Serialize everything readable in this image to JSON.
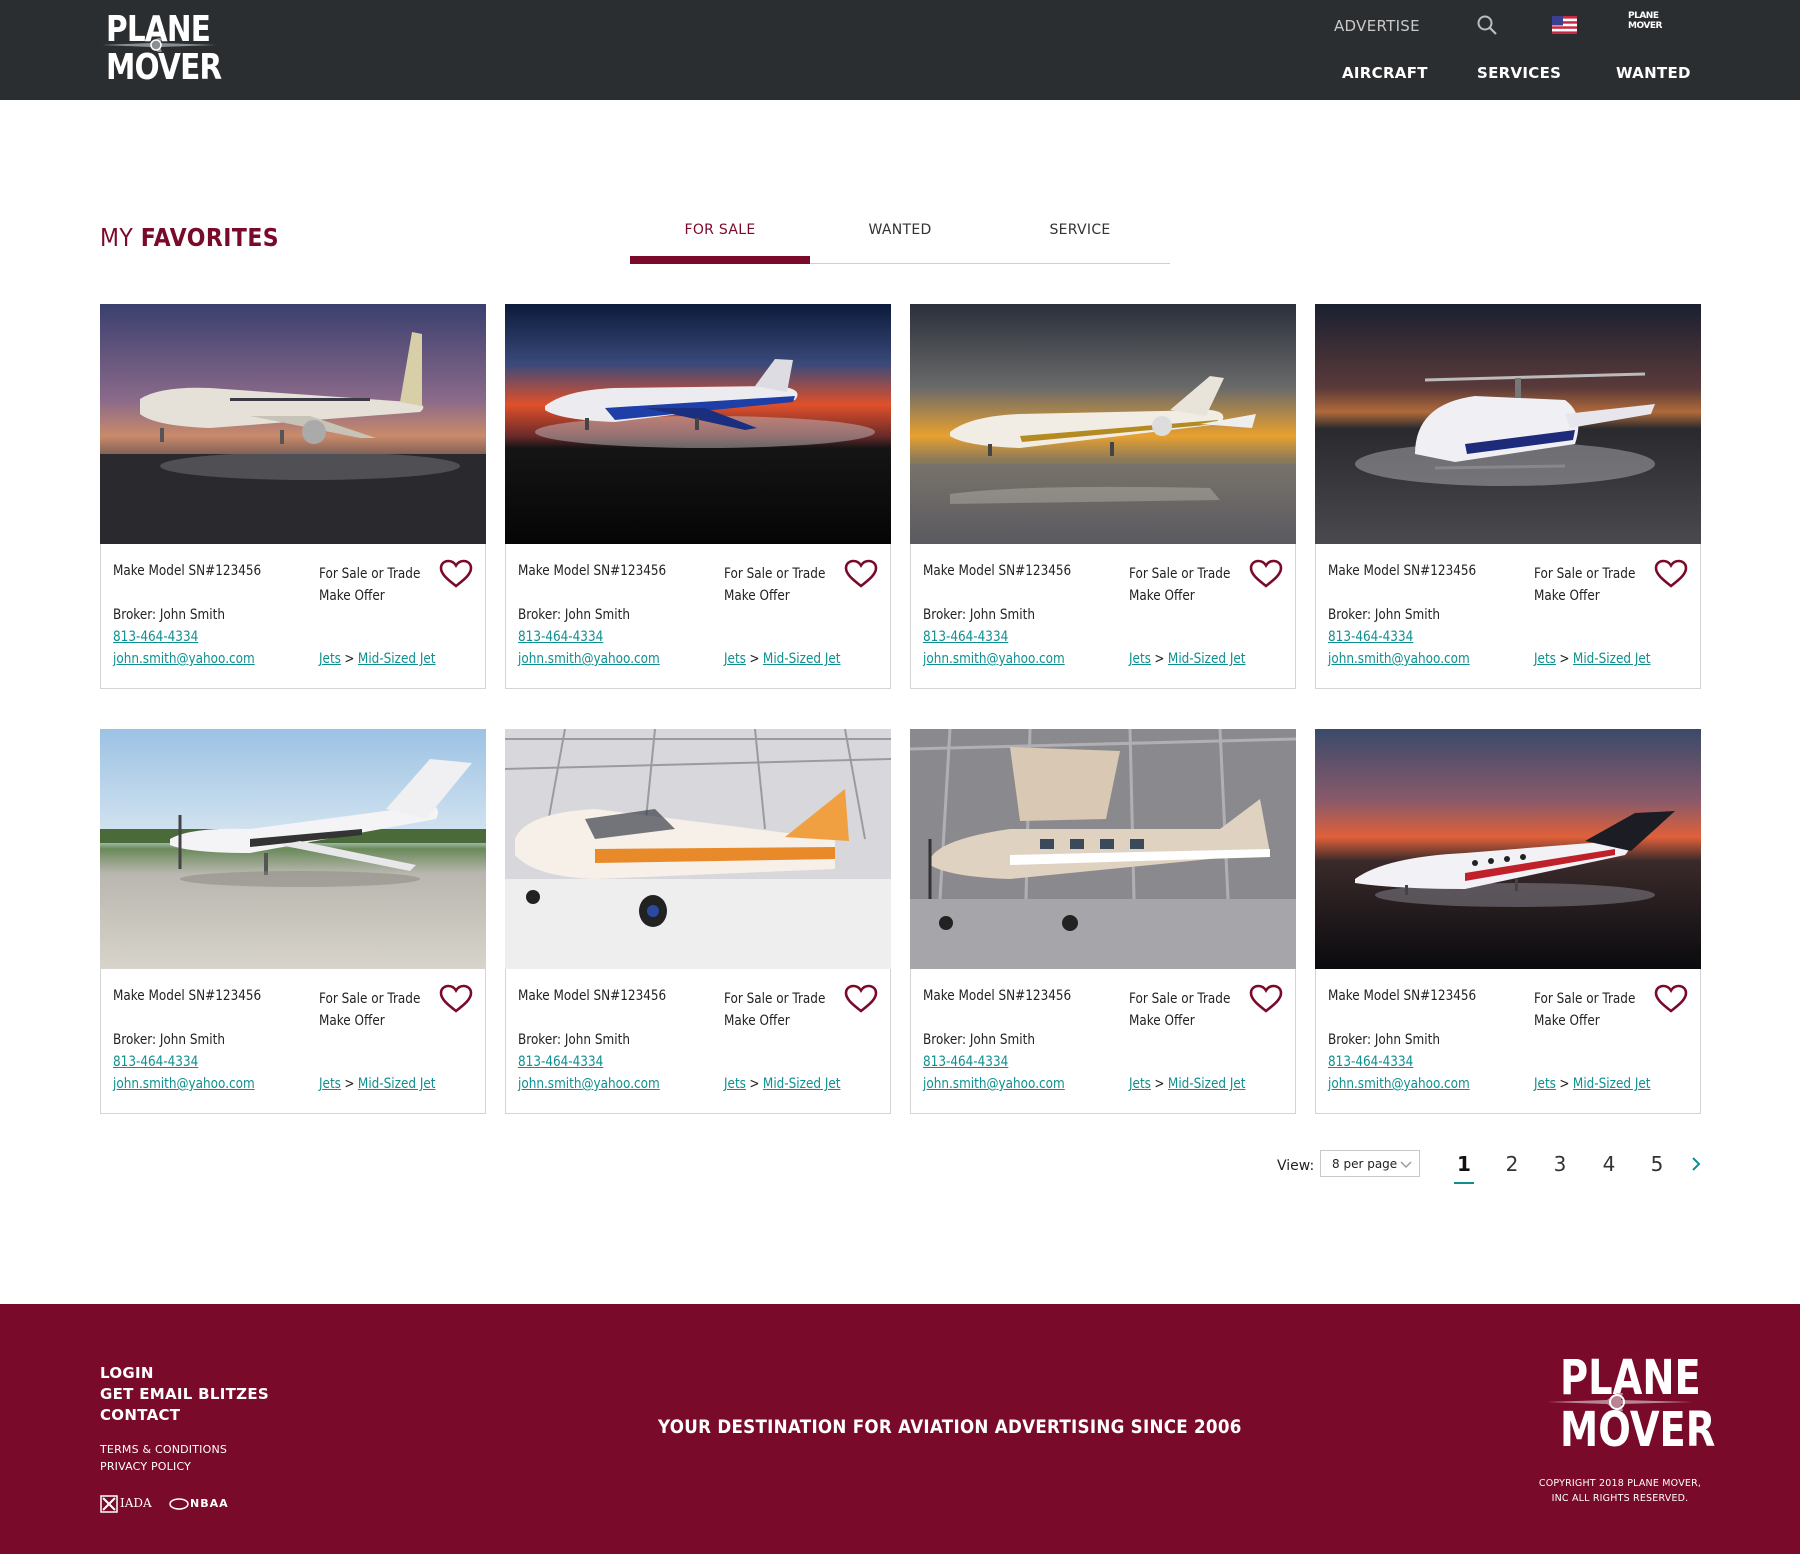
{
  "header": {
    "logo_line1": "PLANE",
    "logo_line2": "MOVER",
    "advertise": "ADVERTISE",
    "search_icon": "search-icon",
    "flag_icon": "us-flag-icon",
    "mini_logo_line1": "PLANE",
    "mini_logo_line2": "MOVER",
    "nav": [
      "AIRCRAFT",
      "SERVICES",
      "WANTED"
    ]
  },
  "title": {
    "light": "MY ",
    "bold": "FAVORITES"
  },
  "tabs": [
    {
      "label": "FOR SALE",
      "active": true
    },
    {
      "label": "WANTED",
      "active": false
    },
    {
      "label": "SERVICE",
      "active": false
    }
  ],
  "cards": [
    {
      "model": "Make Model SN#123456",
      "sale1": "For Sale or Trade",
      "sale2": "Make Offer",
      "broker": "Broker: John Smith",
      "phone": "813-464-4334",
      "email": "john.smith@yahoo.com",
      "cat1": "Jets",
      "sep": ">",
      "cat2": "Mid-Sized Jet",
      "image": "white-gold-airliner-sunset"
    },
    {
      "model": "Make Model SN#123456",
      "sale1": "For Sale or Trade",
      "sale2": "Make Offer",
      "broker": "Broker: John Smith",
      "phone": "813-464-4334",
      "email": "john.smith@yahoo.com",
      "cat1": "Jets",
      "sep": ">",
      "cat2": "Mid-Sized Jet",
      "image": "blue-jet-red-sky"
    },
    {
      "model": "Make Model SN#123456",
      "sale1": "For Sale or Trade",
      "sale2": "Make Offer",
      "broker": "Broker: John Smith",
      "phone": "813-464-4334",
      "email": "john.smith@yahoo.com",
      "cat1": "Jets",
      "sep": ">",
      "cat2": "Mid-Sized Jet",
      "image": "jet-golden-reflection"
    },
    {
      "model": "Make Model SN#123456",
      "sale1": "For Sale or Trade",
      "sale2": "Make Offer",
      "broker": "Broker: John Smith",
      "phone": "813-464-4334",
      "email": "john.smith@yahoo.com",
      "cat1": "Jets",
      "sep": ">",
      "cat2": "Mid-Sized Jet",
      "image": "helicopter-night"
    },
    {
      "model": "Make Model SN#123456",
      "sale1": "For Sale or Trade",
      "sale2": "Make Offer",
      "broker": "Broker: John Smith",
      "phone": "813-464-4334",
      "email": "john.smith@yahoo.com",
      "cat1": "Jets",
      "sep": ">",
      "cat2": "Mid-Sized Jet",
      "image": "turboprop-daylight"
    },
    {
      "model": "Make Model SN#123456",
      "sale1": "For Sale or Trade",
      "sale2": "Make Offer",
      "broker": "Broker: John Smith",
      "phone": "813-464-4334",
      "email": "john.smith@yahoo.com",
      "cat1": "Jets",
      "sep": ">",
      "cat2": "Mid-Sized Jet",
      "image": "orange-piston-hangar"
    },
    {
      "model": "Make Model SN#123456",
      "sale1": "For Sale or Trade",
      "sale2": "Make Offer",
      "broker": "Broker: John Smith",
      "phone": "813-464-4334",
      "email": "john.smith@yahoo.com",
      "cat1": "Jets",
      "sep": ">",
      "cat2": "Mid-Sized Jet",
      "image": "caravan-hangar"
    },
    {
      "model": "Make Model SN#123456",
      "sale1": "For Sale or Trade",
      "sale2": "Make Offer",
      "broker": "Broker: John Smith",
      "phone": "813-464-4334",
      "email": "john.smith@yahoo.com",
      "cat1": "Jets",
      "sep": ">",
      "cat2": "Mid-Sized Jet",
      "image": "small-jet-sunset"
    }
  ],
  "pager": {
    "view_label": "View:",
    "per_page": "8 per page",
    "pages": [
      "1",
      "2",
      "3",
      "4",
      "5"
    ],
    "current": "1"
  },
  "footer": {
    "links": [
      "LOGIN",
      "GET EMAIL BLITZES",
      "CONTACT"
    ],
    "small_links": [
      "TERMS & CONDITIONS",
      "PRIVACY POLICY"
    ],
    "tagline": "YOUR DESTINATION FOR AVIATION ADVERTISING SINCE 2006",
    "logo_line1": "PLANE",
    "logo_line2": "MOVER",
    "copyright1": "COPYRIGHT 2018 PLANE MOVER,",
    "copyright2": "INC ALL RIGHTS RESERVED.",
    "badge1": "IADA",
    "badge2": "NBAA"
  },
  "colors": {
    "brand": "#7a0a2a",
    "link": "#0f8f8f",
    "header_bg": "#2b2e30"
  }
}
